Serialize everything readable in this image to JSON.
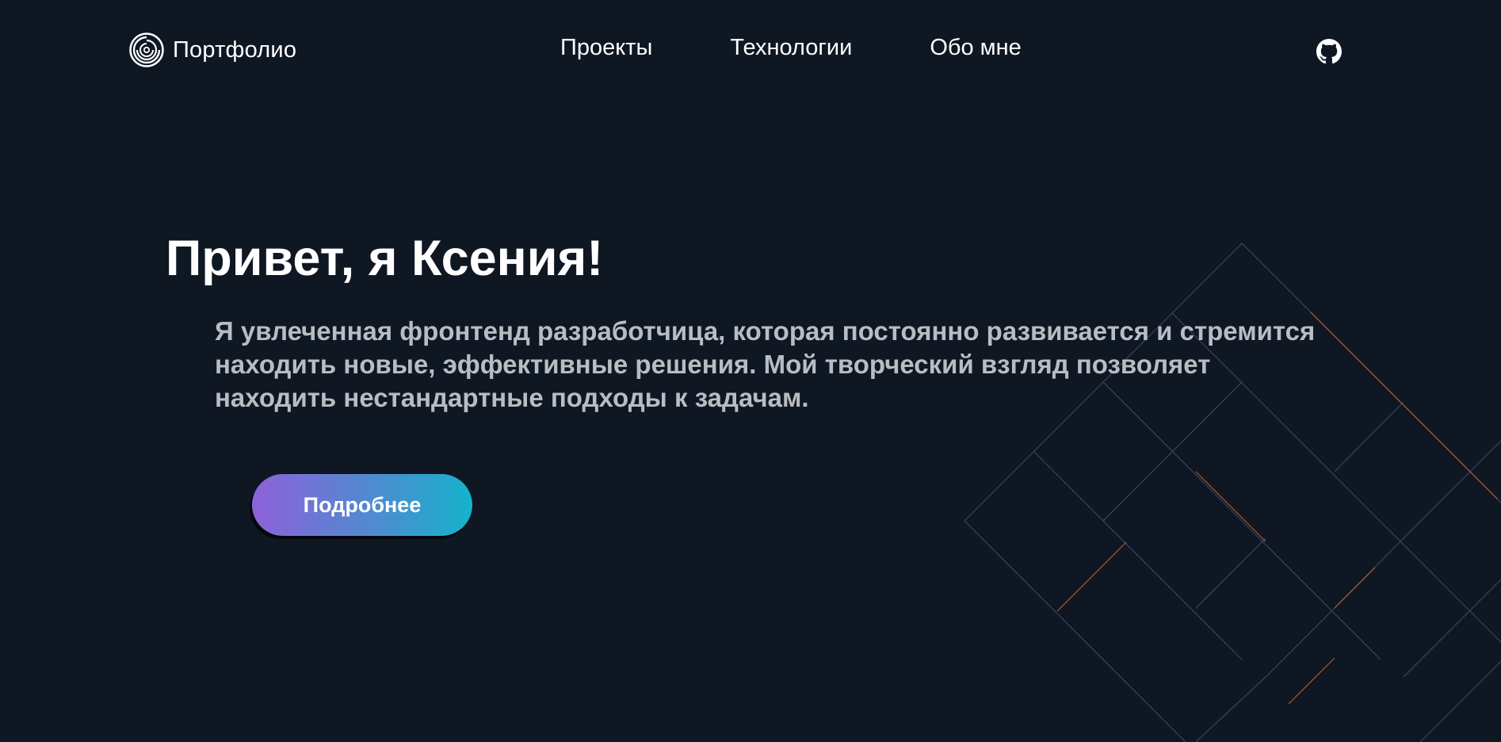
{
  "header": {
    "logo_text": "Портфолио",
    "logo_icon": "spiral-logo-icon",
    "nav": [
      {
        "label": "Проекты"
      },
      {
        "label": "Технологии"
      },
      {
        "label": "Обо мне"
      }
    ],
    "github_icon": "github-icon"
  },
  "hero": {
    "title": "Привет, я Ксения!",
    "description": "Я увлеченная фронтенд разработчица, которая постоянно развивается и стремится находить новые, эффективные решения. Мой творческий взгляд позволяет находить нестандартные подходы к задачам.",
    "button_label": "Подробнее"
  },
  "colors": {
    "background": "#0f1723",
    "text": "#ffffff",
    "muted_text": "#b9bcc1",
    "button_gradient_start": "#8e61d9",
    "button_gradient_end": "#14b3cc",
    "pattern_line": "#3a4461",
    "pattern_accent": "#c2663a"
  }
}
